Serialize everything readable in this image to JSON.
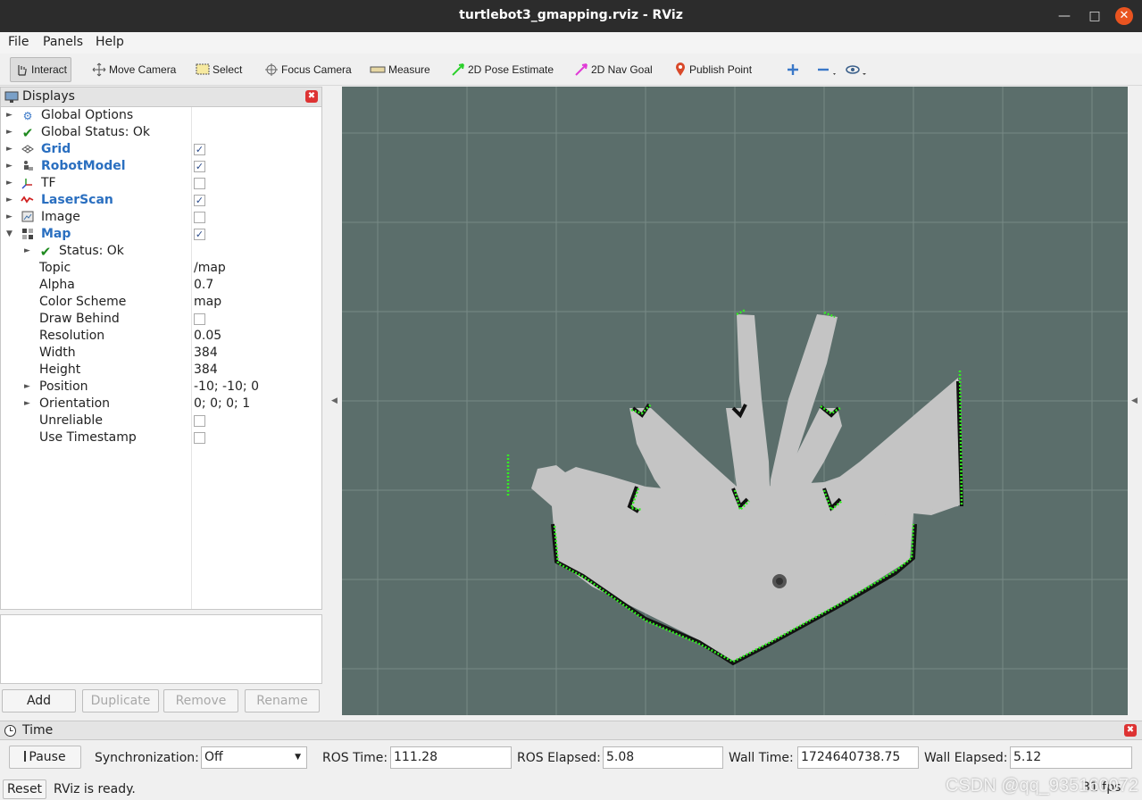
{
  "window": {
    "title": "turtlebot3_gmapping.rviz - RViz"
  },
  "menu": [
    "File",
    "Panels",
    "Help"
  ],
  "toolbar": {
    "interact": "Interact",
    "move_camera": "Move Camera",
    "select": "Select",
    "focus_camera": "Focus Camera",
    "measure": "Measure",
    "pose_estimate": "2D Pose Estimate",
    "nav_goal": "2D Nav Goal",
    "publish_point": "Publish Point"
  },
  "displays": {
    "title": "Displays",
    "items": [
      {
        "label": "Global Options"
      },
      {
        "label": "Global Status: Ok"
      },
      {
        "label": "Grid",
        "checked": true
      },
      {
        "label": "RobotModel",
        "checked": true
      },
      {
        "label": "TF",
        "checked": false
      },
      {
        "label": "LaserScan",
        "checked": true
      },
      {
        "label": "Image",
        "checked": false
      },
      {
        "label": "Map",
        "checked": true
      }
    ],
    "map_props": [
      {
        "label": "Status: Ok",
        "value": ""
      },
      {
        "label": "Topic",
        "value": "/map"
      },
      {
        "label": "Alpha",
        "value": "0.7"
      },
      {
        "label": "Color Scheme",
        "value": "map"
      },
      {
        "label": "Draw Behind",
        "value": ""
      },
      {
        "label": "Resolution",
        "value": "0.05"
      },
      {
        "label": "Width",
        "value": "384"
      },
      {
        "label": "Height",
        "value": "384"
      },
      {
        "label": "Position",
        "value": "-10; -10; 0"
      },
      {
        "label": "Orientation",
        "value": "0; 0; 0; 1"
      },
      {
        "label": "Unreliable",
        "value": ""
      },
      {
        "label": "Use Timestamp",
        "value": ""
      }
    ],
    "buttons": {
      "add": "Add",
      "duplicate": "Duplicate",
      "remove": "Remove",
      "rename": "Rename"
    }
  },
  "time": {
    "title": "Time",
    "pause": "Pause",
    "sync_label": "Synchronization:",
    "sync_value": "Off",
    "ros_time_label": "ROS Time:",
    "ros_time": "111.28",
    "ros_elapsed_label": "ROS Elapsed:",
    "ros_elapsed": "5.08",
    "wall_time_label": "Wall Time:",
    "wall_time": "1724640738.75",
    "wall_elapsed_label": "Wall Elapsed:",
    "wall_elapsed": "5.12"
  },
  "status": {
    "reset": "Reset",
    "message": "RViz is ready.",
    "fps": "31 fps"
  },
  "watermark": "CSDN @qq_935160072",
  "colors": {
    "viewport_bg": "#5b6e6b",
    "grid": "#778986",
    "free": "#c4c4c4",
    "occupied": "#111111",
    "laser": "#33ee22",
    "accent": "#2a6fc0"
  }
}
